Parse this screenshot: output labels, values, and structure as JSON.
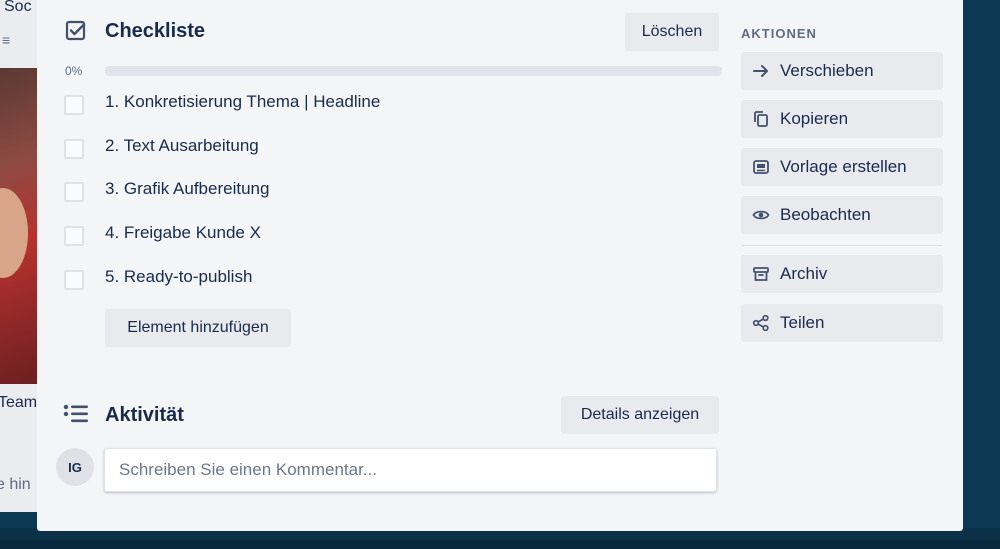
{
  "background": {
    "card_title": "Soc",
    "team_text": "Team",
    "hint_text": "e hin"
  },
  "checklist": {
    "title": "Checkliste",
    "delete_label": "Löschen",
    "progress_label": "0%",
    "progress_value": 0,
    "items": [
      {
        "label": "1. Konkretisierung Thema | Headline",
        "checked": false
      },
      {
        "label": "2. Text Ausarbeitung",
        "checked": false
      },
      {
        "label": "3. Grafik Aufbereitung",
        "checked": false
      },
      {
        "label": "4. Freigabe Kunde X",
        "checked": false
      },
      {
        "label": "5. Ready-to-publish",
        "checked": false
      }
    ],
    "add_item_label": "Element hinzufügen"
  },
  "activity": {
    "title": "Aktivität",
    "details_label": "Details anzeigen",
    "avatar_initials": "IG",
    "comment_placeholder": "Schreiben Sie einen Kommentar..."
  },
  "actions": {
    "heading": "AKTIONEN",
    "items": [
      {
        "label": "Verschieben",
        "icon": "arrow-right-icon"
      },
      {
        "label": "Kopieren",
        "icon": "copy-icon"
      },
      {
        "label": "Vorlage erstellen",
        "icon": "template-icon"
      },
      {
        "label": "Beobachten",
        "icon": "eye-icon"
      },
      {
        "label": "Archiv",
        "icon": "archive-icon"
      },
      {
        "label": "Teilen",
        "icon": "share-icon"
      }
    ]
  },
  "colors": {
    "board_background": "#0c3953",
    "modal_background": "#f4f5f7",
    "button_background": "#e9eaee",
    "text_primary": "#172b4d",
    "text_subtle": "#5e6c84"
  }
}
